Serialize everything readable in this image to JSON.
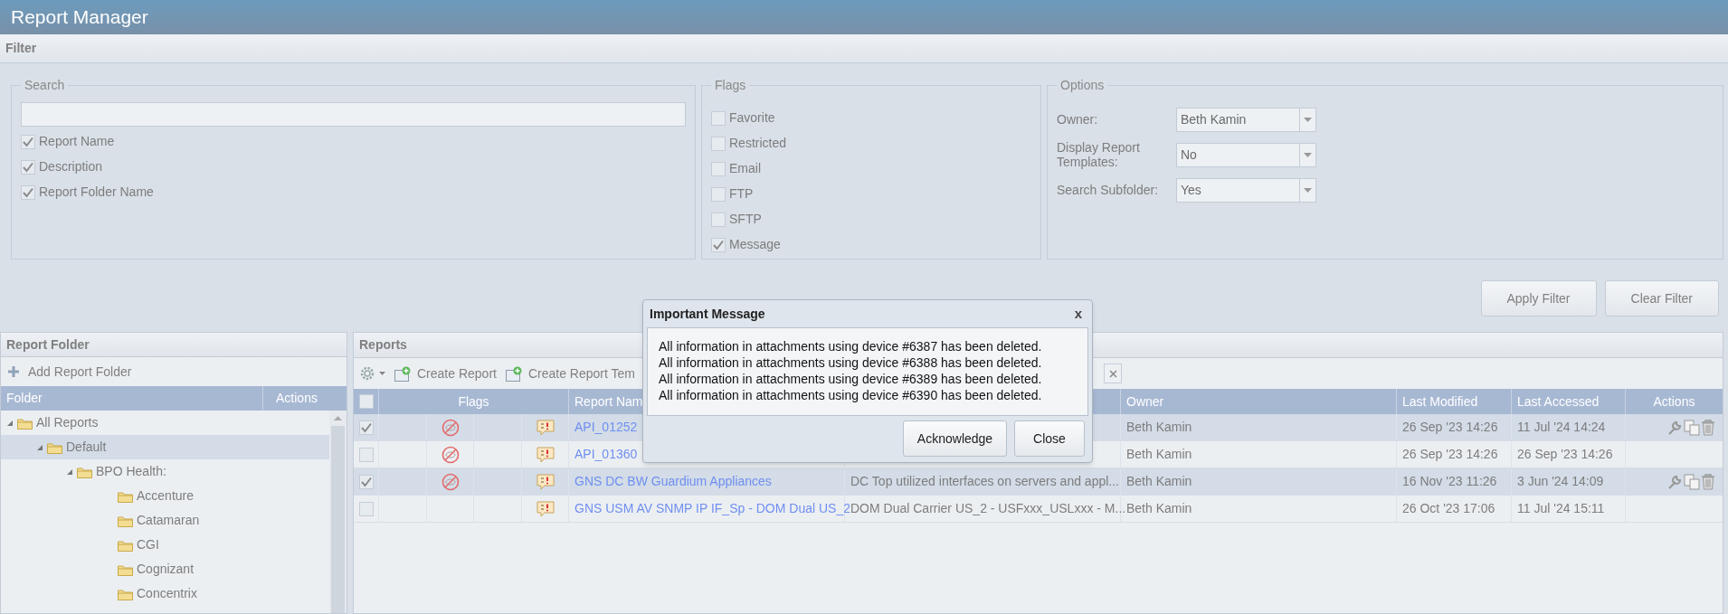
{
  "window": {
    "title": "Report Manager"
  },
  "filter": {
    "title": "Filter",
    "search": {
      "legend": "Search",
      "options": [
        {
          "label": "Report Name",
          "checked": true
        },
        {
          "label": "Description",
          "checked": true
        },
        {
          "label": "Report Folder Name",
          "checked": true
        }
      ]
    },
    "flags": {
      "legend": "Flags",
      "items": [
        {
          "label": "Favorite",
          "checked": false
        },
        {
          "label": "Restricted",
          "checked": false
        },
        {
          "label": "Email",
          "checked": false
        },
        {
          "label": "FTP",
          "checked": false
        },
        {
          "label": "SFTP",
          "checked": false
        },
        {
          "label": "Message",
          "checked": true
        }
      ]
    },
    "options": {
      "legend": "Options",
      "fields": [
        {
          "label": "Owner:",
          "value": "Beth Kamin"
        },
        {
          "label": "Display Report Templates:",
          "value": "No"
        },
        {
          "label": "Search Subfolder:",
          "value": "Yes"
        }
      ]
    },
    "buttons": [
      "Apply Filter",
      "Clear Filter"
    ]
  },
  "report_folder": {
    "title": "Report Folder",
    "add_button": "Add Report Folder",
    "columns": [
      "Folder",
      "Actions"
    ],
    "tree": [
      {
        "label": "All Reports",
        "expanded": true,
        "selected": false,
        "children": [
          {
            "label": "Default",
            "expanded": true,
            "selected": true,
            "children": [
              {
                "label": "BPO Health:",
                "expanded": true,
                "selected": false,
                "children": [
                  {
                    "label": "Accenture",
                    "selected": false
                  },
                  {
                    "label": "Catamaran",
                    "selected": false
                  },
                  {
                    "label": "CGI",
                    "selected": false
                  },
                  {
                    "label": "Cognizant",
                    "selected": false
                  },
                  {
                    "label": "Concentrix",
                    "selected": false
                  }
                ]
              }
            ]
          }
        ]
      }
    ]
  },
  "reports": {
    "title": "Reports",
    "select_all": false,
    "toolbar": [
      "Create Report",
      "Create Report Tem"
    ],
    "columns": {
      "flags": "Flags",
      "report_name": "Report Nam",
      "owner": "Owner",
      "last_modified": "Last Modified",
      "last_accessed": "Last Accessed",
      "actions": "Actions"
    },
    "rows": [
      {
        "checked": true,
        "restricted": true,
        "message": true,
        "name": "API_01252",
        "owner": "Beth Kamin",
        "last_modified": "26 Sep '23 14:26",
        "last_accessed": "11 Jul '24 14:24",
        "actions": true
      },
      {
        "checked": false,
        "restricted": true,
        "message": true,
        "name": "API_01360",
        "owner": "Beth Kamin",
        "last_modified": "26 Sep '23 14:26",
        "last_accessed": "26 Sep '23 14:26",
        "actions": false
      },
      {
        "checked": true,
        "restricted": true,
        "message": true,
        "name": "GNS DC BW Guardium Appliances",
        "description": "DC Top utilized interfaces on servers and appl...",
        "owner": "Beth Kamin",
        "last_modified": "16 Nov '23 11:26",
        "last_accessed": "3 Jun '24 14:09",
        "actions": true
      },
      {
        "checked": false,
        "restricted": false,
        "message": true,
        "name": "GNS USM AV SNMP IP IF_Sp - DOM Dual US_2",
        "description": "DOM Dual Carrier US_2 - USFxxx_USLxxx - M...",
        "owner": "Beth Kamin",
        "last_modified": "26 Oct '23 17:06",
        "last_accessed": "11 Jul '24 15:11",
        "actions": false
      }
    ]
  },
  "dialog": {
    "title": "Important Message",
    "close": "x",
    "messages": [
      "All information in attachments using device #6387 has been deleted.",
      "All information in attachments using device #6388 has been deleted.",
      "All information in attachments using device #6389 has been deleted.",
      "All information in attachments using device #6390 has been deleted."
    ],
    "buttons": [
      "Acknowledge",
      "Close"
    ]
  }
}
